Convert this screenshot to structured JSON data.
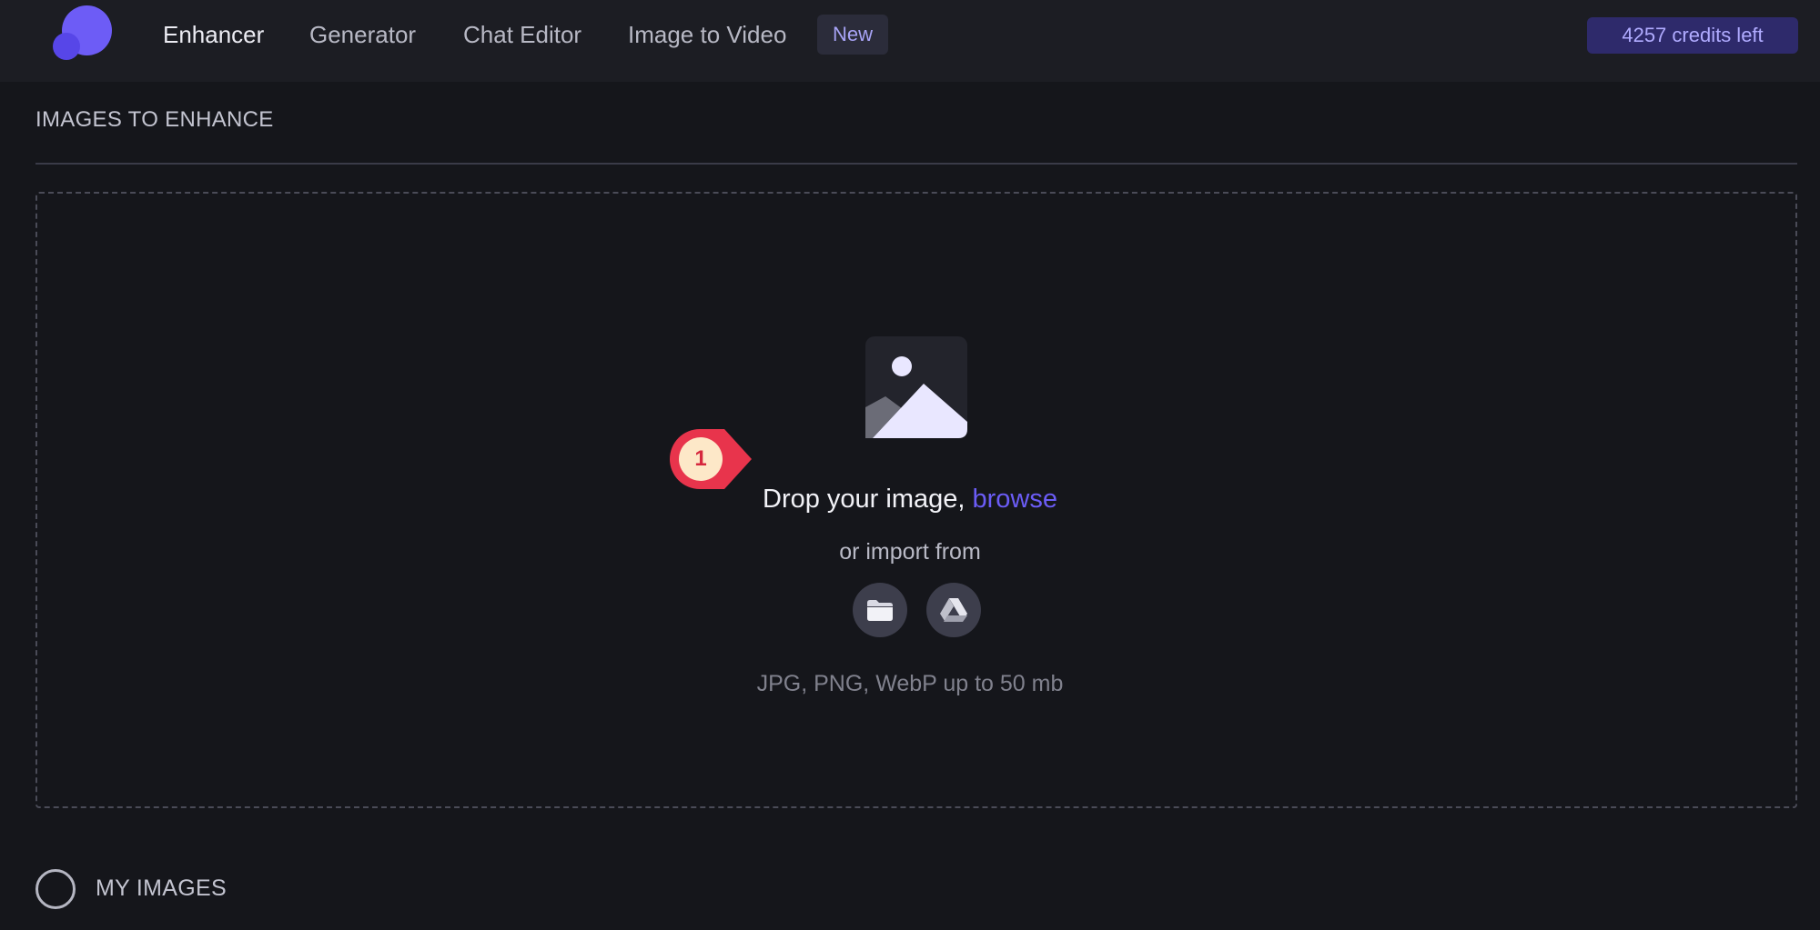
{
  "header": {
    "nav": [
      {
        "label": "Enhancer",
        "active": true
      },
      {
        "label": "Generator",
        "active": false
      },
      {
        "label": "Chat Editor",
        "active": false
      },
      {
        "label": "Image to Video",
        "active": false
      }
    ],
    "new_badge": "New",
    "credits": "4257 credits left"
  },
  "main": {
    "section_title": "IMAGES TO ENHANCE",
    "dropzone": {
      "icon": "image-placeholder-icon",
      "callout_number": "1",
      "drop_text": "Drop your image,",
      "browse_link": "browse",
      "import_text": "or import from",
      "import_sources": [
        {
          "icon": "folder-icon"
        },
        {
          "icon": "google-drive-icon"
        }
      ],
      "formats": "JPG, PNG, WebP up to 50 mb"
    },
    "my_images": {
      "label": "MY IMAGES",
      "selected": false
    }
  },
  "colors": {
    "accent": "#6b5cf6",
    "background": "#15161b",
    "header": "#1c1d23",
    "callout": "#d6283e"
  }
}
